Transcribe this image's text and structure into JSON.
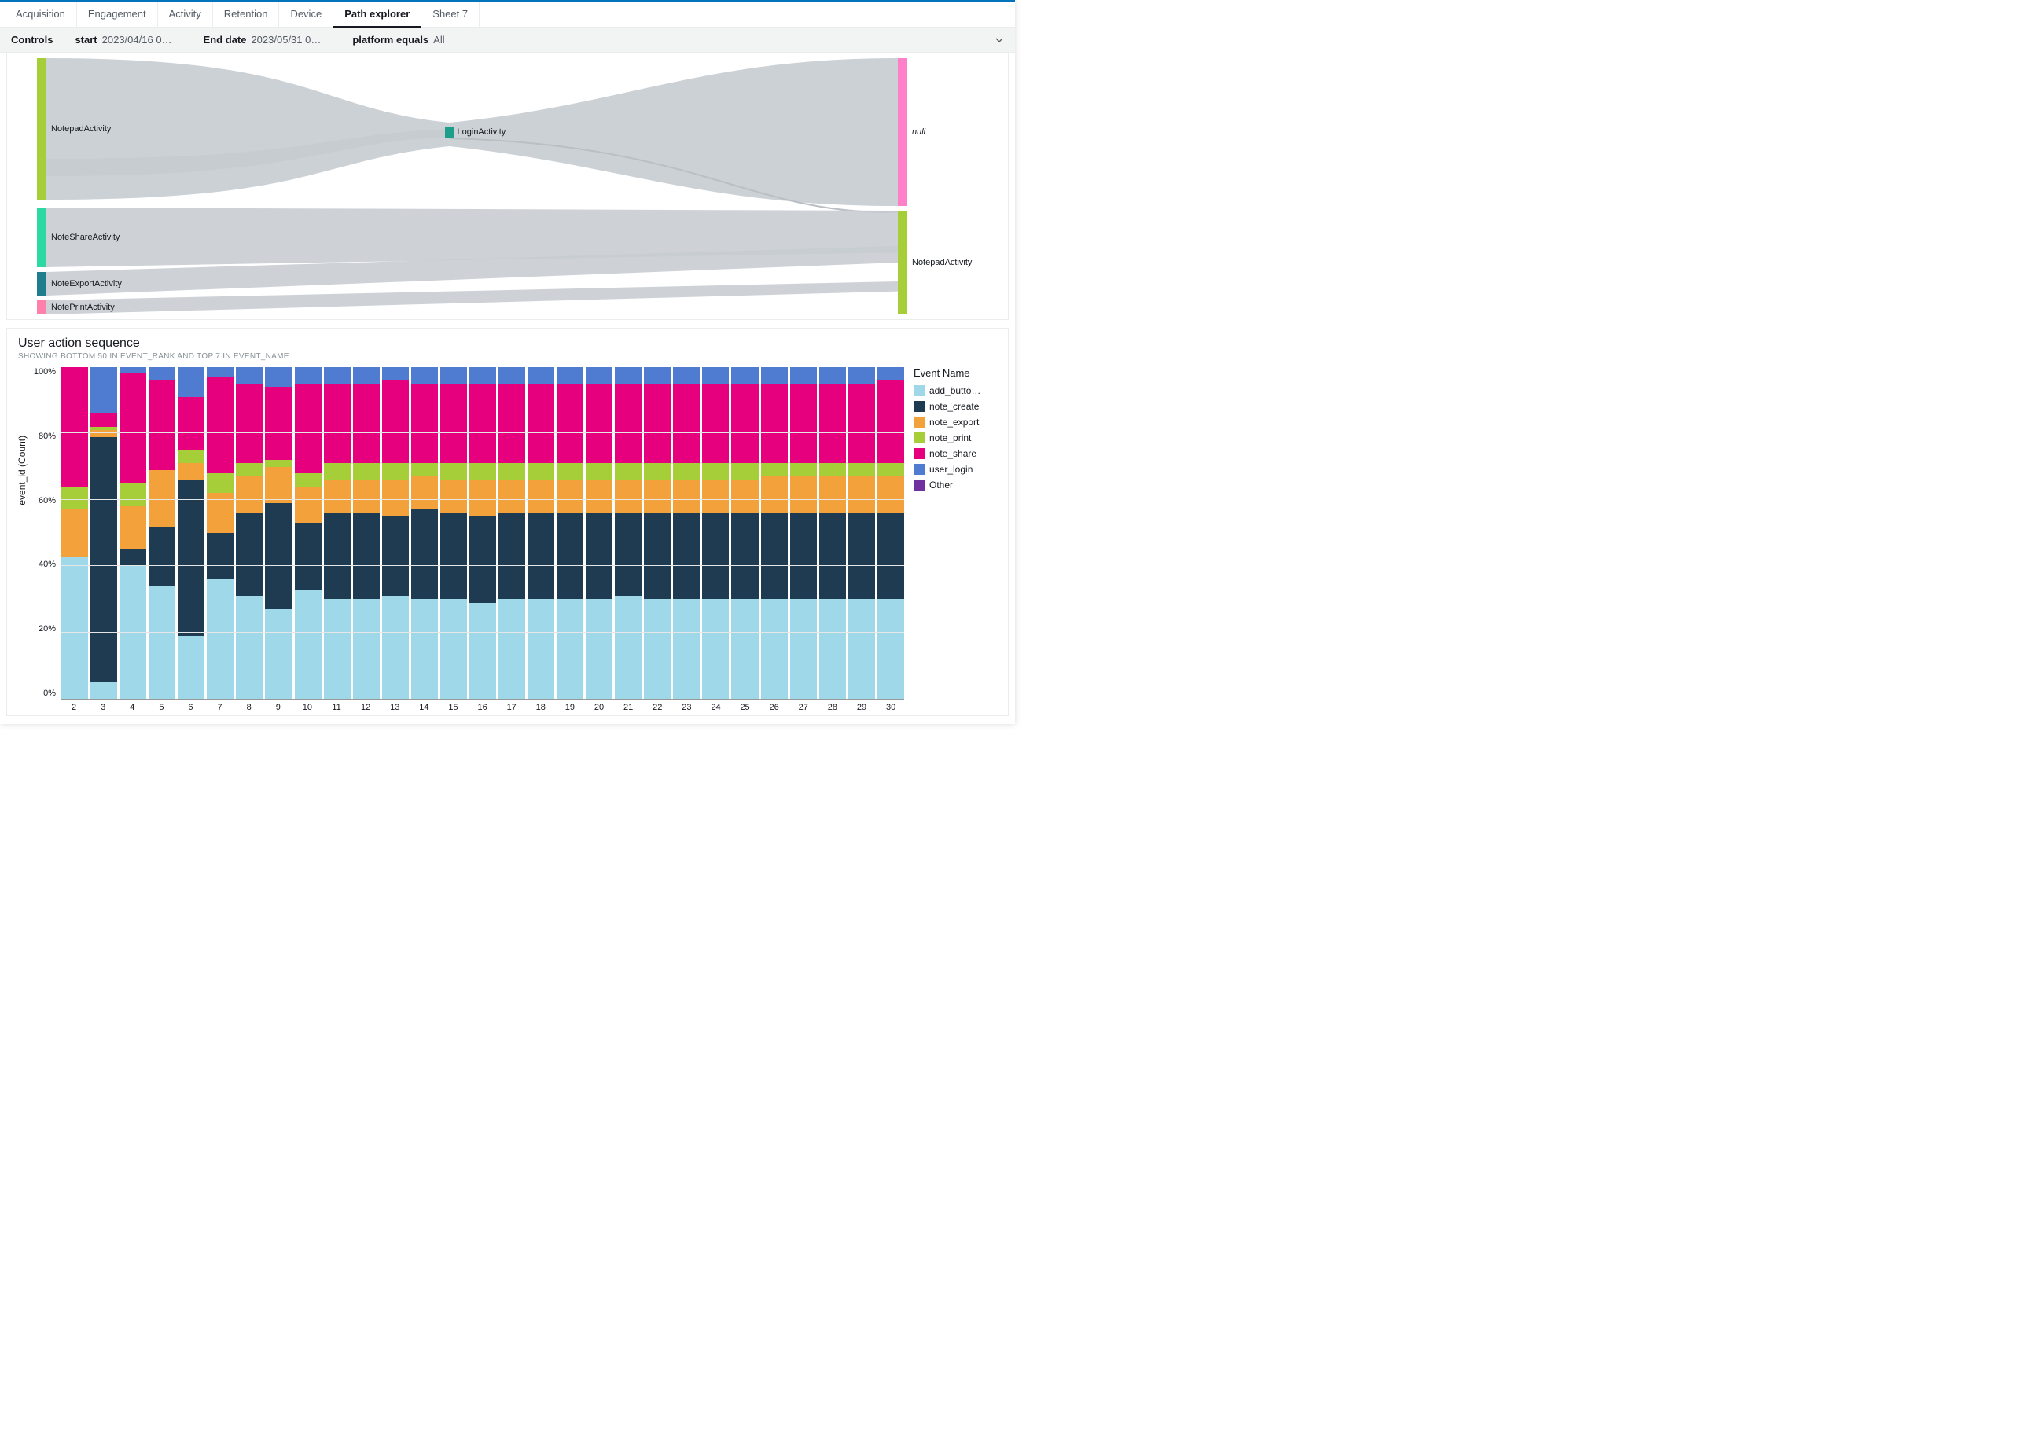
{
  "tabs": [
    "Acquisition",
    "Engagement",
    "Activity",
    "Retention",
    "Device",
    "Path explorer",
    "Sheet 7"
  ],
  "active_tab": 5,
  "controls": {
    "label": "Controls",
    "items": [
      {
        "k": "start",
        "v": "2023/04/16 0…"
      },
      {
        "k": "End date",
        "v": "2023/05/31 0…"
      },
      {
        "k": "platform equals",
        "v": "All"
      }
    ]
  },
  "sankey": {
    "left_nodes": [
      {
        "label": "NotepadActivity",
        "color": "#a6ce39",
        "top": 0,
        "h": 180
      },
      {
        "label": "NoteShareActivity",
        "color": "#2cd9a3",
        "top": 190,
        "h": 76
      },
      {
        "label": "NoteExportActivity",
        "color": "#1f7e8c",
        "top": 272,
        "h": 30
      },
      {
        "label": "NotePrintActivity",
        "color": "#ff80ab",
        "top": 308,
        "h": 18
      }
    ],
    "mid_node": {
      "label": "LoginActivity",
      "color": "#1b9e8a",
      "top": 88,
      "h": 14
    },
    "right_nodes": [
      {
        "label": "null",
        "color": "#ff80c8",
        "top": 0,
        "h": 188,
        "italic": true
      },
      {
        "label": "NotepadActivity",
        "color": "#a6ce39",
        "top": 194,
        "h": 132
      }
    ]
  },
  "bar_panel": {
    "title": "User action sequence",
    "subtitle": "SHOWING BOTTOM 50 IN EVENT_RANK AND TOP 7 IN EVENT_NAME",
    "ylabel": "event_id (Count)",
    "yticks": [
      "100%",
      "80%",
      "60%",
      "40%",
      "20%",
      "0%"
    ],
    "legend_title": "Event Name",
    "legend": [
      {
        "name": "add_butto…",
        "color": "#9fd8e8"
      },
      {
        "name": "note_create",
        "color": "#1f3b52"
      },
      {
        "name": "note_export",
        "color": "#f2a13b"
      },
      {
        "name": "note_print",
        "color": "#a6ce39"
      },
      {
        "name": "note_share",
        "color": "#e6007e"
      },
      {
        "name": "user_login",
        "color": "#4f7cd1"
      },
      {
        "name": "Other",
        "color": "#7030a0"
      }
    ]
  },
  "chart_data": {
    "type": "bar",
    "stacked": true,
    "normalize": "100%",
    "title": "User action sequence",
    "xlabel": "",
    "ylabel": "event_id (Count)",
    "ylim": [
      0,
      100
    ],
    "categories": [
      2,
      3,
      4,
      5,
      6,
      7,
      8,
      9,
      10,
      11,
      12,
      13,
      14,
      15,
      16,
      17,
      18,
      19,
      20,
      21,
      22,
      23,
      24,
      25,
      26,
      27,
      28,
      29,
      30
    ],
    "series": [
      {
        "name": "add_button",
        "color": "#9fd8e8",
        "values": [
          43,
          5,
          40,
          34,
          19,
          36,
          31,
          27,
          33,
          30,
          30,
          31,
          30,
          30,
          29,
          30,
          30,
          30,
          30,
          31,
          30,
          30,
          30,
          30,
          30,
          30,
          30,
          30,
          30
        ]
      },
      {
        "name": "note_create",
        "color": "#1f3b52",
        "values": [
          0,
          74,
          5,
          18,
          47,
          14,
          25,
          32,
          20,
          26,
          26,
          24,
          27,
          26,
          26,
          26,
          26,
          26,
          26,
          25,
          26,
          26,
          26,
          26,
          26,
          26,
          26,
          26,
          26
        ]
      },
      {
        "name": "note_export",
        "color": "#f2a13b",
        "values": [
          14,
          2,
          13,
          17,
          5,
          12,
          11,
          11,
          11,
          10,
          10,
          11,
          10,
          10,
          11,
          10,
          10,
          10,
          10,
          10,
          10,
          10,
          10,
          10,
          11,
          11,
          11,
          11,
          11
        ]
      },
      {
        "name": "note_print",
        "color": "#a6ce39",
        "values": [
          7,
          1,
          7,
          0,
          4,
          6,
          4,
          2,
          4,
          5,
          5,
          5,
          4,
          5,
          5,
          5,
          5,
          5,
          5,
          5,
          5,
          5,
          5,
          5,
          4,
          4,
          4,
          4,
          4
        ]
      },
      {
        "name": "note_share",
        "color": "#e6007e",
        "values": [
          36,
          4,
          33,
          27,
          16,
          29,
          24,
          22,
          27,
          24,
          24,
          25,
          24,
          24,
          24,
          24,
          24,
          24,
          24,
          24,
          24,
          24,
          24,
          24,
          24,
          24,
          24,
          24,
          25
        ]
      },
      {
        "name": "user_login",
        "color": "#4f7cd1",
        "values": [
          0,
          14,
          2,
          4,
          9,
          3,
          5,
          6,
          5,
          5,
          5,
          4,
          5,
          5,
          5,
          5,
          5,
          5,
          5,
          5,
          5,
          5,
          5,
          5,
          5,
          5,
          5,
          5,
          4
        ]
      },
      {
        "name": "Other",
        "color": "#7030a0",
        "values": [
          0,
          0,
          0,
          0,
          0,
          0,
          0,
          0,
          0,
          0,
          0,
          0,
          0,
          0,
          0,
          0,
          0,
          0,
          0,
          0,
          0,
          0,
          0,
          0,
          0,
          0,
          0,
          0,
          0
        ]
      }
    ]
  }
}
